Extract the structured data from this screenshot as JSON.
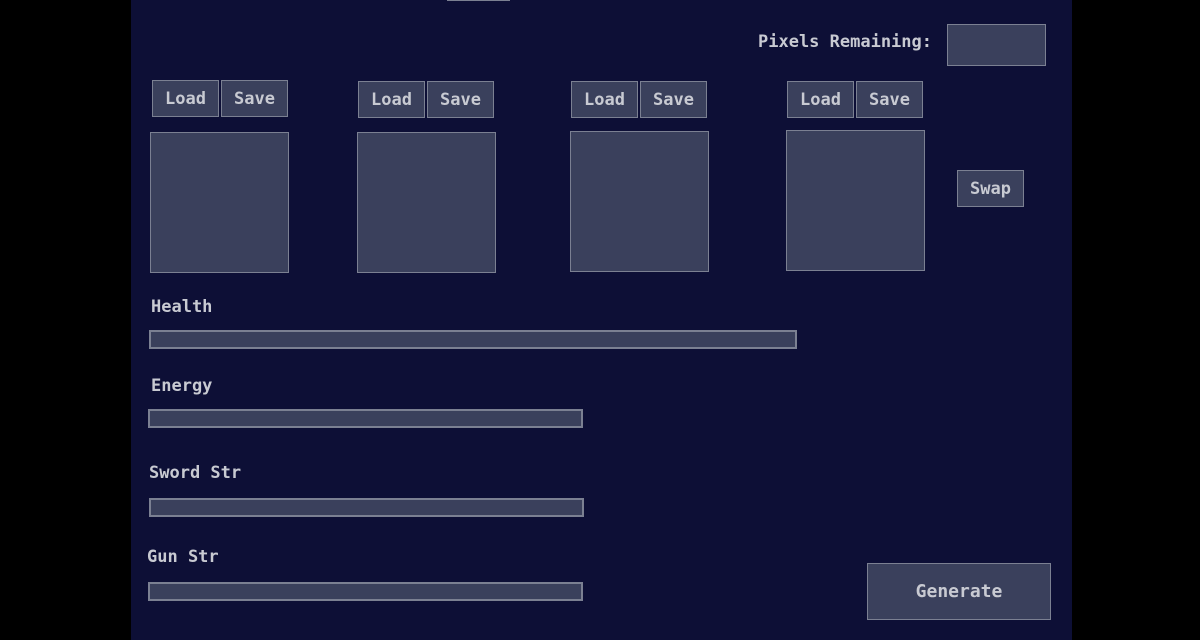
{
  "header": {
    "pixels_remaining_label": "Pixels Remaining:",
    "pixels_remaining_value": ""
  },
  "slots": [
    {
      "load_label": "Load",
      "save_label": "Save"
    },
    {
      "load_label": "Load",
      "save_label": "Save"
    },
    {
      "load_label": "Load",
      "save_label": "Save"
    },
    {
      "load_label": "Load",
      "save_label": "Save"
    }
  ],
  "swap_label": "Swap",
  "stats": {
    "health_label": "Health",
    "energy_label": "Energy",
    "sword_label": "Sword Str",
    "gun_label": "Gun Str"
  },
  "generate_label": "Generate",
  "colors": {
    "background": "#0d0f36",
    "widget_fill": "#3a405c",
    "widget_border": "#7b8092",
    "text": "#c8cad2"
  }
}
